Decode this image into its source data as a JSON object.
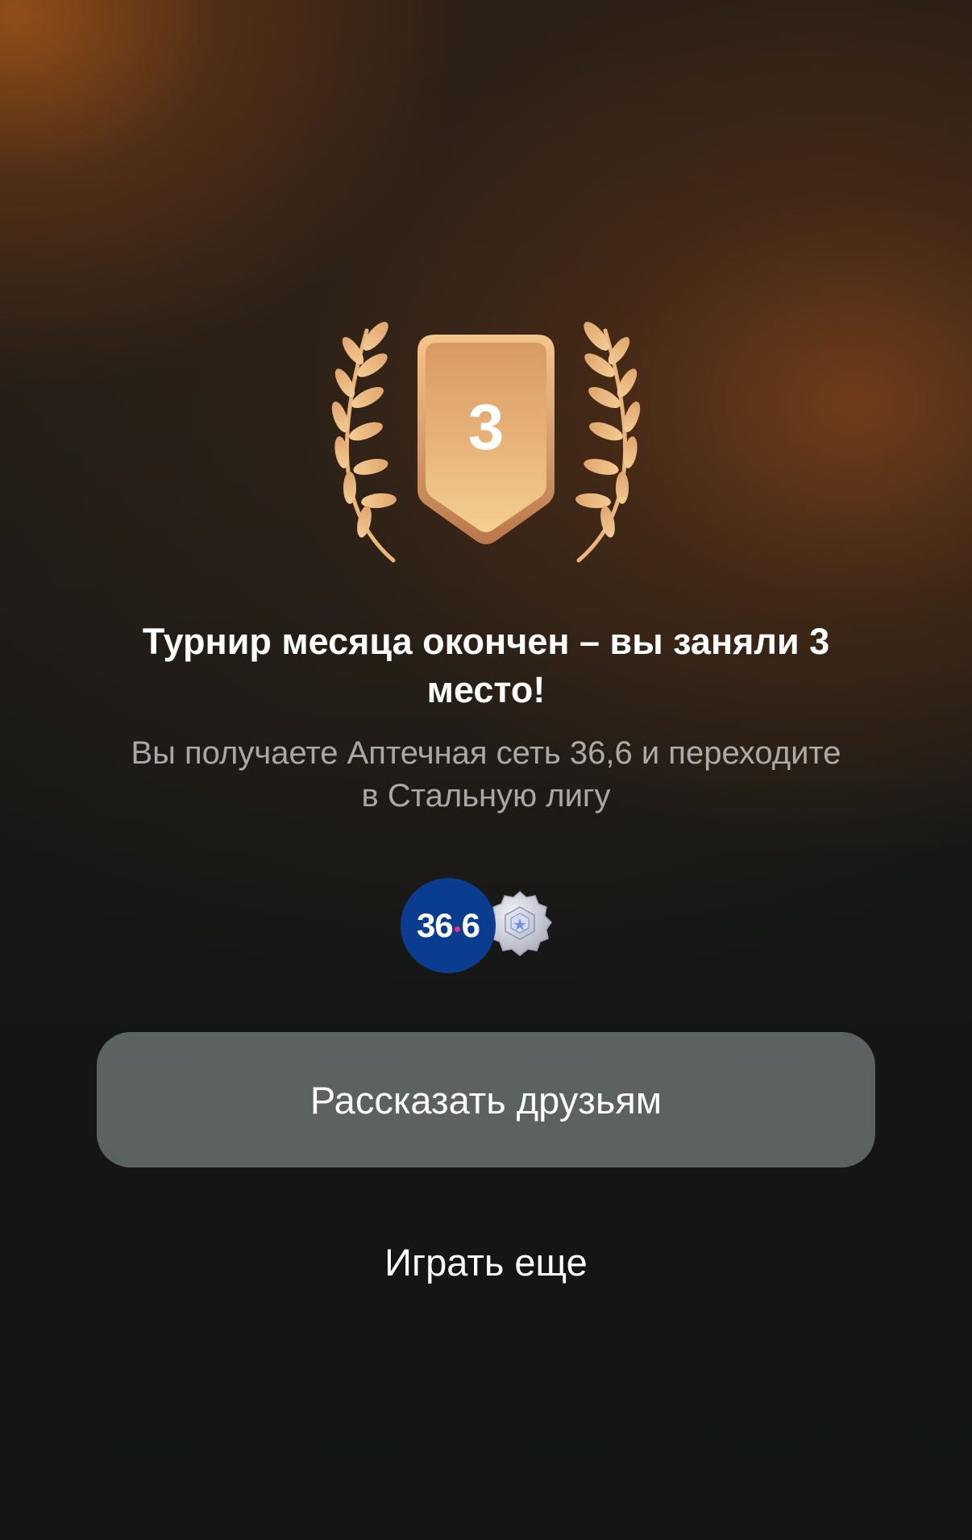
{
  "badge": {
    "place": "3",
    "icon": "laurel-shield-badge-icon",
    "color_light": "#f6cc8e",
    "color_dark": "#c98a55"
  },
  "result": {
    "title": "Турнир месяца окончен – вы заняли 3 место!",
    "subtitle": "Вы получаете Аптечная сеть 36,6 и переходите в Стальную лигу"
  },
  "rewards": {
    "pharmacy_logo_left": "36",
    "pharmacy_logo_right": "6",
    "pharmacy_color": "#0a3d8f",
    "league_icon": "steel-league-badge-icon"
  },
  "actions": {
    "share_label": "Рассказать друзьям",
    "play_again_label": "Играть еще"
  }
}
